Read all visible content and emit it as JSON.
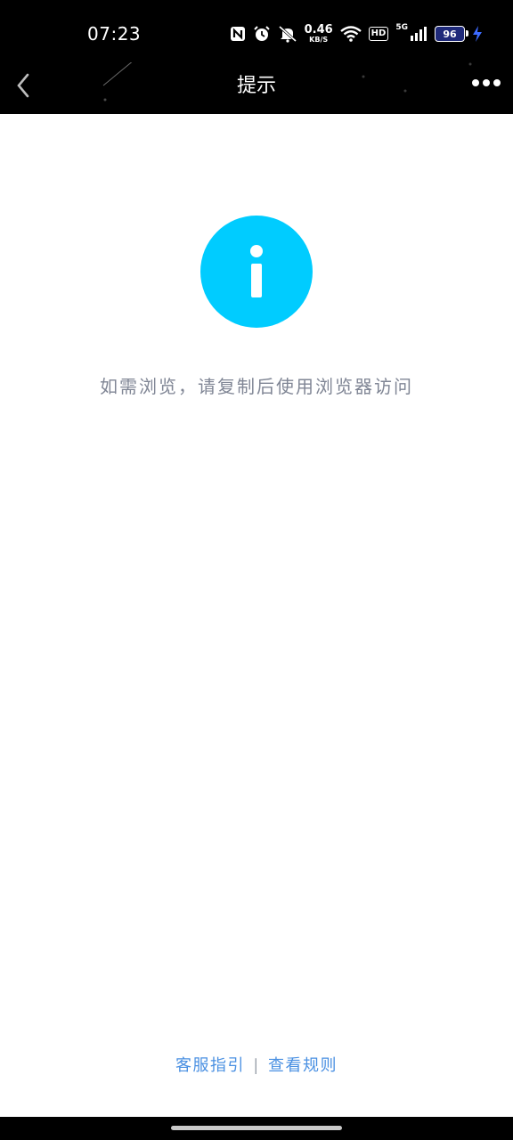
{
  "status_bar": {
    "time": "07:23",
    "net_speed_value": "0.46",
    "net_speed_unit": "KB/S",
    "hd_label": "HD",
    "signal_label": "5G",
    "battery_level": "96",
    "icons": [
      "nfc-icon",
      "alarm-icon",
      "mute-icon",
      "wifi-icon",
      "signal-icon",
      "charging-icon"
    ]
  },
  "nav": {
    "title": "提示",
    "back_icon": "chevron-left-icon",
    "more_icon": "more-dots-icon"
  },
  "main": {
    "icon": "info-icon",
    "icon_color": "#00CCFF",
    "message": "如需浏览，请复制后使用浏览器访问"
  },
  "footer": {
    "link_service": "客服指引",
    "separator": "|",
    "link_rules": "查看规则",
    "link_color": "#4A90E2"
  }
}
